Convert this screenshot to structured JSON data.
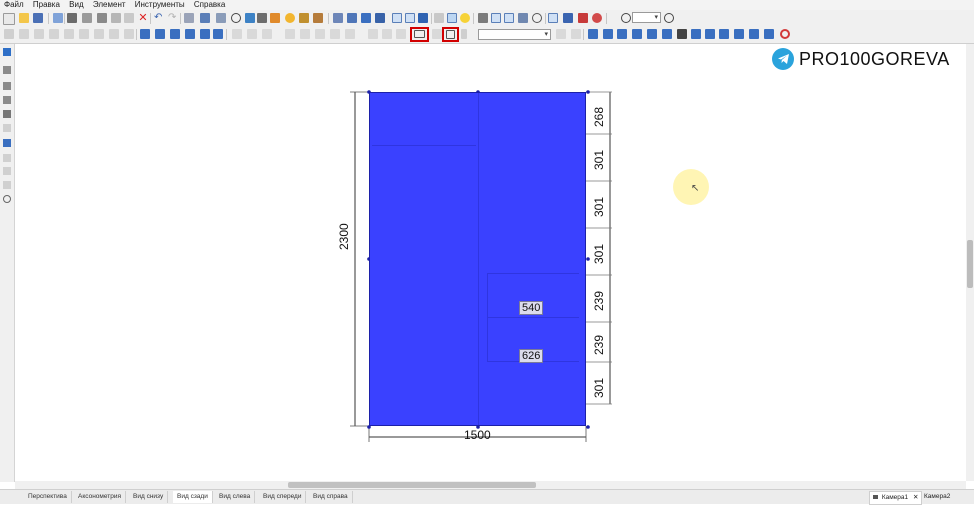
{
  "menu": [
    "Файл",
    "Правка",
    "Вид",
    "Элемент",
    "Инструменты",
    "Справка"
  ],
  "toolbar": {
    "zoom_value": "",
    "style_select_value": ""
  },
  "brand": {
    "text": "PRO100GOREVA",
    "icon": "telegram-icon"
  },
  "drawing": {
    "height_label": "2300",
    "width_label": "1500",
    "right_dims": [
      "268",
      "301",
      "301",
      "301",
      "239",
      "239",
      "301"
    ],
    "drawer_dims": [
      "540",
      "626"
    ],
    "panel_color": "#3a41ff"
  },
  "tabs": [
    "Перспектива",
    "Аксонометрия",
    "Вид снизу",
    "Вид сзади",
    "Вид слева",
    "Вид спереди",
    "Вид справа"
  ],
  "active_tab": "Вид сзади",
  "cameras": [
    "Камера1",
    "Камера2"
  ],
  "annotation_color": "#d20000"
}
